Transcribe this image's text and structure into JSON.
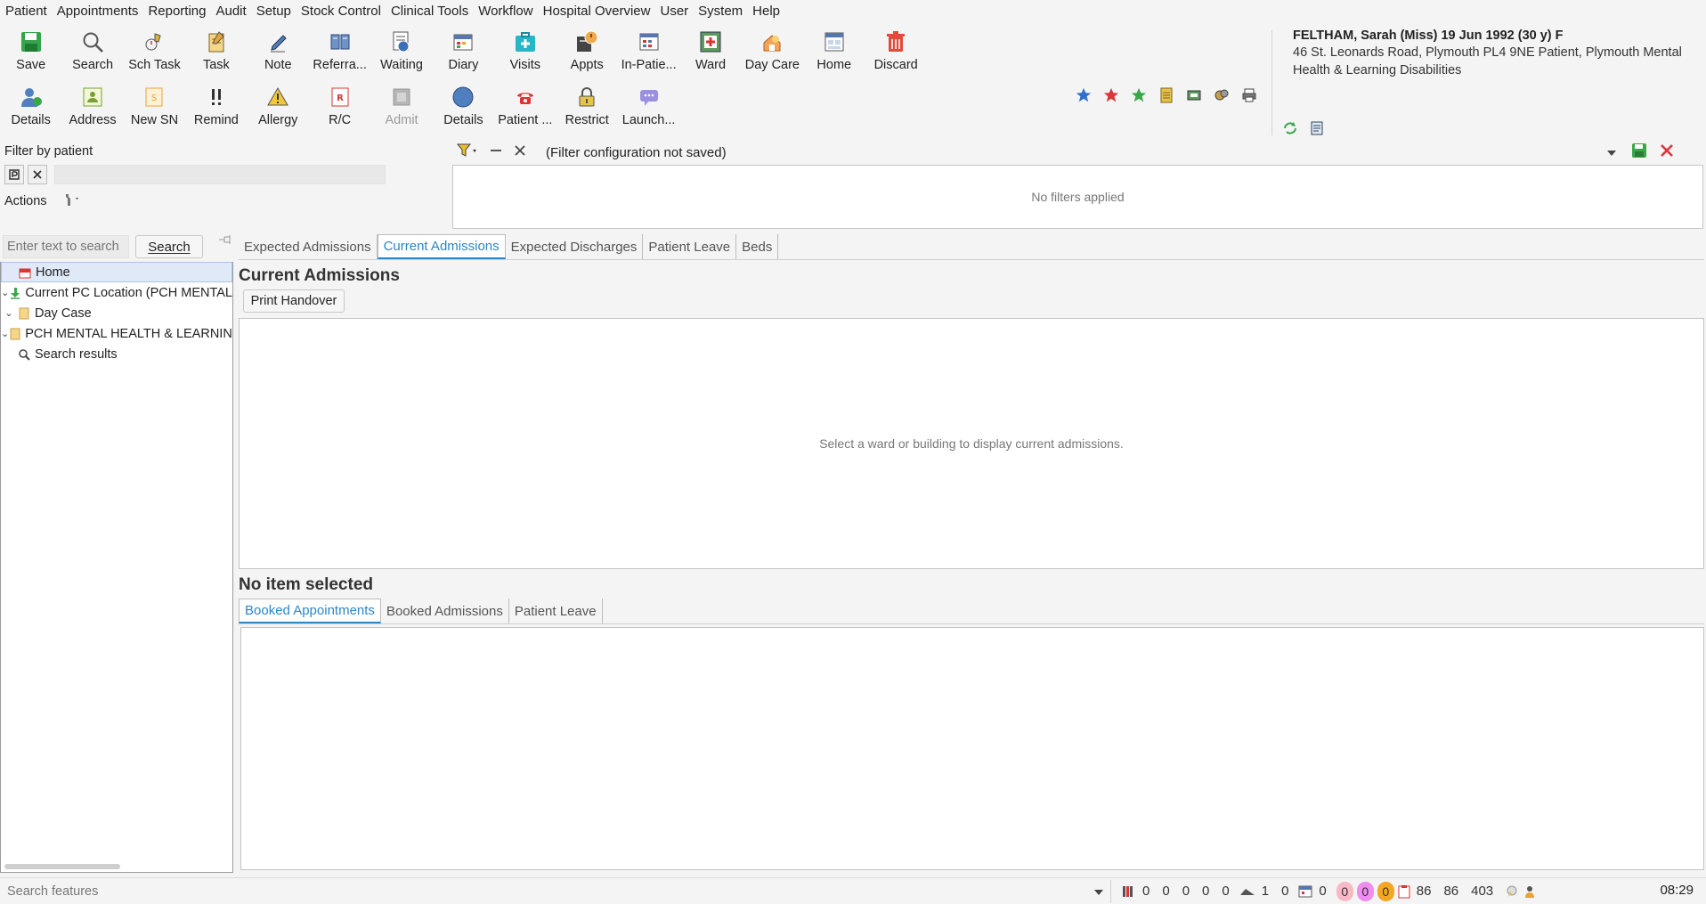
{
  "menu": [
    {
      "label": "Patient",
      "key": "i"
    },
    {
      "label": "Appointments",
      "key": ""
    },
    {
      "label": "Reporting",
      "key": ""
    },
    {
      "label": "Audit",
      "key": ""
    },
    {
      "label": "Setup",
      "key": ""
    },
    {
      "label": "Stock Control",
      "key": ""
    },
    {
      "label": "Clinical Tools",
      "key": ""
    },
    {
      "label": "Workflow",
      "key": ""
    },
    {
      "label": "Hospital Overview",
      "key": ""
    },
    {
      "label": "User",
      "key": ""
    },
    {
      "label": "System",
      "key": ""
    },
    {
      "label": "Help",
      "key": ""
    }
  ],
  "toolbar": {
    "row1": [
      "Save",
      "Search",
      "Sch Task",
      "Task",
      "Note",
      "Referra...",
      "Waiting",
      "Diary",
      "Visits",
      "Appts",
      "In-Patie...",
      "Ward",
      "Day Care",
      "Home",
      "Discard"
    ],
    "row2": [
      "Details",
      "Address",
      "New SN",
      "Remind",
      "Allergy",
      "R/C",
      "Admit",
      "Details",
      "Patient ...",
      "Restrict",
      "Launch..."
    ]
  },
  "patient": {
    "name": "FELTHAM, Sarah (Miss) 19 Jun 1992 (30 y) F",
    "address": "46 St. Leonards Road, Plymouth PL4 9NE  Patient, Plymouth Mental Health & Learning Disabilities"
  },
  "filter": {
    "label": "Filter by patient",
    "actions_label": "Actions",
    "config_text": "(Filter configuration not saved)",
    "empty_text": "No filters applied"
  },
  "search": {
    "placeholder": "Enter text to search",
    "button": "Search"
  },
  "tree": [
    {
      "label": "Home",
      "caret": "",
      "icon": "home-icon",
      "selected": true
    },
    {
      "label": "Current PC Location (PCH MENTAL",
      "caret": "⌄",
      "icon": "download-arrow-icon",
      "selected": false
    },
    {
      "label": "Day Case",
      "caret": "⌄",
      "icon": "folder-icon",
      "selected": false
    },
    {
      "label": "PCH MENTAL HEALTH & LEARNING",
      "caret": "⌄",
      "icon": "folder-icon",
      "selected": false
    },
    {
      "label": "Search results",
      "caret": "",
      "icon": "magnifier-icon",
      "selected": false
    }
  ],
  "tabs_top": [
    "Expected Admissions",
    "Current Admissions",
    "Expected Discharges",
    "Patient Leave",
    "Beds"
  ],
  "tabs_top_active": 1,
  "current": {
    "title": "Current Admissions",
    "print_button": "Print Handover",
    "empty_text": "Select a ward or building to display current admissions."
  },
  "detail": {
    "title": "No item selected"
  },
  "tabs_bottom": [
    "Booked Appointments",
    "Booked Admissions",
    "Patient Leave"
  ],
  "tabs_bottom_active": 0,
  "status": {
    "search_placeholder": "Search features",
    "group1": [
      "0",
      "0",
      "0",
      "0",
      "0"
    ],
    "group2": [
      "1",
      "0"
    ],
    "group3": [
      "0"
    ],
    "badges": [
      {
        "value": "0",
        "color": "#f7b9c6"
      },
      {
        "value": "0",
        "color": "#f08bf0"
      },
      {
        "value": "0",
        "color": "#f5a623"
      }
    ],
    "group4": [
      "86",
      "86",
      "403"
    ],
    "time": "08:29"
  }
}
